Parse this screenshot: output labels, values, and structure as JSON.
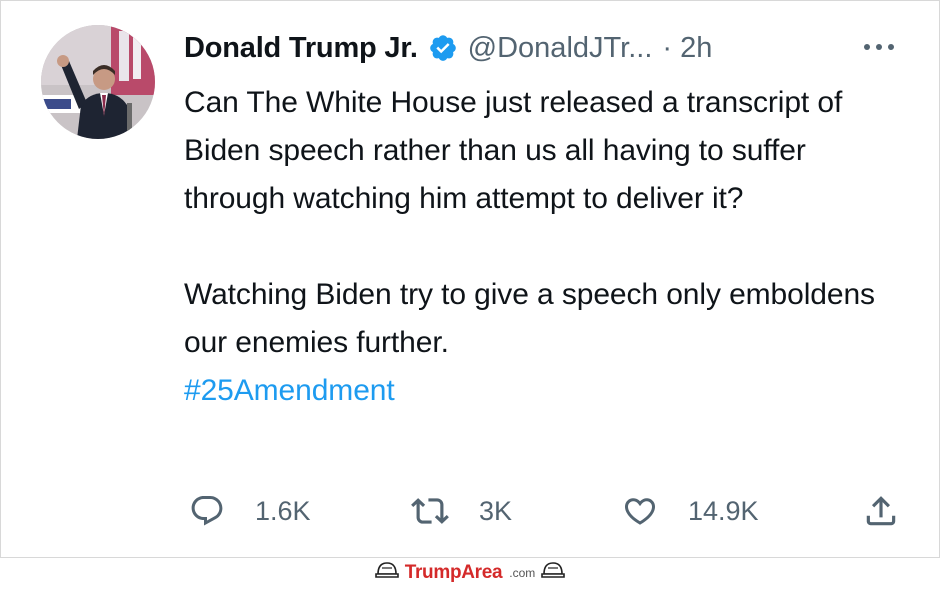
{
  "tweet": {
    "author": {
      "display_name": "Donald Trump Jr.",
      "handle": "@DonaldJTr...",
      "verified": true
    },
    "separator": "·",
    "timestamp": "2h",
    "more_icon": "more-horizontal-icon",
    "paragraph_1": "Can The White House just released a transcript of Biden speech rather than us all having to suffer through watching him attempt to deliver it?",
    "paragraph_2": "Watching Biden try to give a speech only emboldens our enemies further.",
    "hashtag": "#25Amendment",
    "actions": {
      "reply": {
        "icon": "reply-icon",
        "count": "1.6K"
      },
      "retweet": {
        "icon": "retweet-icon",
        "count": "3K"
      },
      "like": {
        "icon": "heart-icon",
        "count": "14.9K"
      },
      "share": {
        "icon": "share-icon"
      }
    }
  },
  "footer": {
    "brand_main": "TrumpArea",
    "brand_suffix": ".com"
  },
  "colors": {
    "text_primary": "#0f1419",
    "text_secondary": "#536471",
    "link": "#1d9bf0",
    "verified_badge": "#1d9bf0",
    "brand_red": "#d42a2a"
  }
}
